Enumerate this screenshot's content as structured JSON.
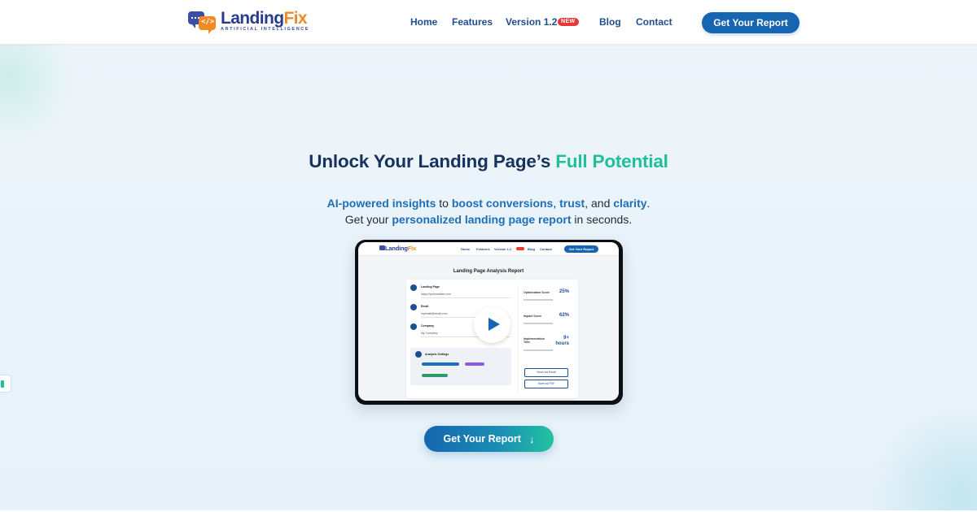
{
  "nav": {
    "logo_word_part1": "Landing",
    "logo_word_part2": "Fix",
    "logo_tagline": "ARTIFICIAL INTELLIGENCE",
    "links": {
      "home": "Home",
      "features": "Features",
      "version": "Version 1.2",
      "version_badge": "NEW",
      "blog": "Blog",
      "contact": "Contact"
    },
    "cta_label": "Get Your Report"
  },
  "hero": {
    "title_main": "Unlock Your Landing Page’s",
    "title_accent": "Full Potential",
    "subtitle": {
      "h1": "AI-powered insights",
      "t1": " to ",
      "h2": "boost conversions",
      "t2": ", ",
      "h3": "trust",
      "t3": ", and ",
      "h4": "clarity",
      "t4": ".",
      "t5": "Get your ",
      "h5": "personalized landing page report",
      "t6": " in seconds."
    }
  },
  "preview": {
    "logo_part1": "Landing",
    "logo_part2": "Fix",
    "nav_links": [
      "Home",
      "Features",
      "Version 1.2",
      "Blog",
      "Contact"
    ],
    "cta_label": "Get Your Report",
    "report_title": "Landing Page Analysis Report",
    "fields": [
      {
        "label": "Landing Page",
        "value": "https://yourwebsite.com"
      },
      {
        "label": "Email",
        "value": "myemail@email.com"
      },
      {
        "label": "Company",
        "value": "My Company"
      }
    ],
    "settings_label": "Analysis Settings",
    "metrics": [
      {
        "label": "Optimization Score",
        "value": "25%"
      },
      {
        "label": "Impact Score",
        "value": "62%"
      },
      {
        "label": "Implementation Time",
        "value": "9+ hours"
      }
    ],
    "buttons": [
      "Send via Email",
      "Save as PDF"
    ]
  },
  "main_cta": {
    "label": "Get Your Report",
    "icon": "arrow-down-icon"
  },
  "colors": {
    "primary": "#1565b0",
    "accent": "#1fbf9a",
    "title": "#17325f",
    "badge": "#e53935",
    "logo_orange": "#f08a24"
  }
}
